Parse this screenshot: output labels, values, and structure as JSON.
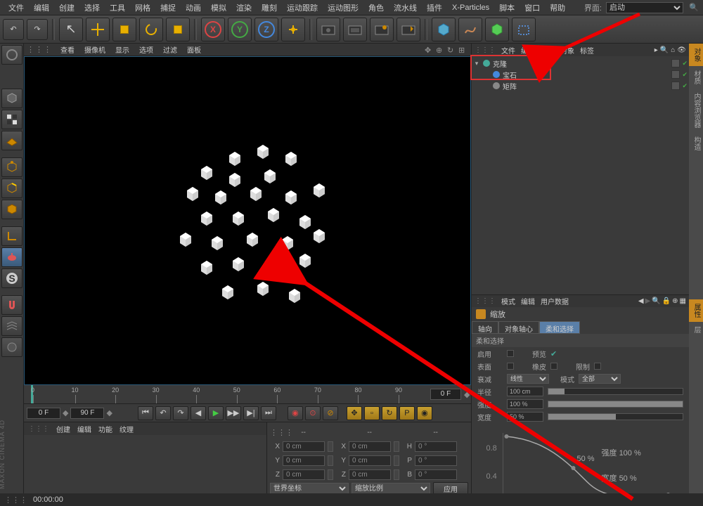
{
  "menu": [
    "文件",
    "编辑",
    "创建",
    "选择",
    "工具",
    "网格",
    "捕捉",
    "动画",
    "模拟",
    "渲染",
    "雕刻",
    "运动跟踪",
    "运动图形",
    "角色",
    "流水线",
    "插件",
    "X-Particles",
    "脚本",
    "窗口",
    "帮助"
  ],
  "interface_label": "界面:",
  "interface_value": "启动",
  "axes": {
    "x": "X",
    "y": "Y",
    "z": "Z"
  },
  "vpmenu": [
    "查看",
    "摄像机",
    "显示",
    "选项",
    "过滤",
    "面板"
  ],
  "timeline": {
    "ticks": [
      "0",
      "10",
      "20",
      "30",
      "40",
      "50",
      "60",
      "70",
      "80",
      "90"
    ],
    "end": "0 F",
    "from": "0 F",
    "to": "90 F"
  },
  "play_spin": "◆",
  "mat_menu": [
    "创建",
    "编辑",
    "功能",
    "纹理"
  ],
  "coord": {
    "dash": "--",
    "x": "X",
    "y": "Y",
    "z": "Z",
    "h": "H",
    "p": "P",
    "b": "B",
    "val": "0 cm",
    "ang": "0 °",
    "sys": "世界坐标",
    "mode": "缩放比例",
    "apply": "应用"
  },
  "obj_menu": [
    "文件",
    "编辑",
    "查看",
    "对象",
    "标签"
  ],
  "objects": [
    {
      "name": "克隆",
      "icon": "#4a9",
      "indent": 0,
      "exp": "▾"
    },
    {
      "name": "宝石",
      "icon": "#48d",
      "indent": 1,
      "exp": ""
    },
    {
      "name": "矩阵",
      "icon": "#888",
      "indent": 1,
      "exp": ""
    }
  ],
  "attr_menu": [
    "模式",
    "编辑",
    "用户数据"
  ],
  "attr_title": "缩放",
  "attr_tabs": [
    "轴向",
    "对象轴心",
    "柔和选择"
  ],
  "group": "柔和选择",
  "rows": {
    "enable": "启用",
    "preview": "预览",
    "surface": "表面",
    "rubber": "橡皮",
    "limit": "限制",
    "falloff": "衰减",
    "falloff_v": "线性",
    "mode": "模式",
    "mode_v": "全部",
    "radius": "半径",
    "radius_v": "100 cm",
    "strength": "强度",
    "strength_v": "100 %",
    "width": "宽度",
    "width_v": "50 %"
  },
  "curve": {
    "y1": "0.8",
    "y2": "0.4",
    "l1": "50 %",
    "s": "强度",
    "sv": "100 %",
    "w": "宽度",
    "wv": "50 %"
  },
  "rtabs": [
    "对象",
    "材质",
    "内容浏览器",
    "构造"
  ],
  "rtabs2": [
    "属性",
    "层"
  ],
  "status_time": "00:00:00",
  "brand": "MAXON CINEMA 4D"
}
